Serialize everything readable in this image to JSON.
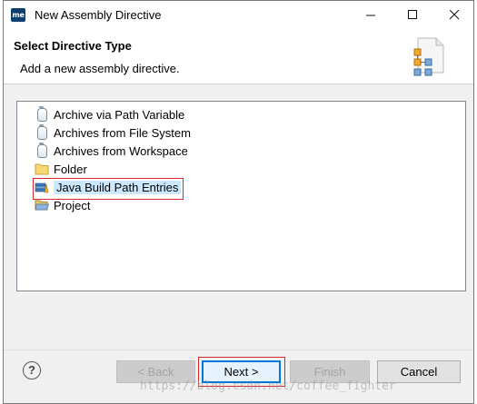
{
  "window": {
    "app_icon_text": "me",
    "title": "New Assembly Directive",
    "controls": [
      "minimize",
      "maximize",
      "close"
    ]
  },
  "header": {
    "title": "Select Directive Type",
    "description": "Add a new assembly directive."
  },
  "tree": {
    "items": [
      {
        "label": "Archive via Path Variable",
        "icon": "jar-icon",
        "selected": false
      },
      {
        "label": "Archives from File System",
        "icon": "jar-icon",
        "selected": false
      },
      {
        "label": "Archives from Workspace",
        "icon": "jar-icon",
        "selected": false
      },
      {
        "label": "Folder",
        "icon": "folder-icon",
        "selected": false
      },
      {
        "label": "Java Build Path Entries",
        "icon": "library-icon",
        "selected": true
      },
      {
        "label": "Project",
        "icon": "project-folder-icon",
        "selected": false
      }
    ]
  },
  "buttons": {
    "help": "?",
    "back": "< Back",
    "next": "Next >",
    "finish": "Finish",
    "cancel": "Cancel"
  },
  "watermark": "https://blog.csdn.net/coffee_fighter",
  "colors": {
    "highlight_red": "#d9282a",
    "selection": "#cce8ff",
    "default_button_border": "#0078d7"
  }
}
